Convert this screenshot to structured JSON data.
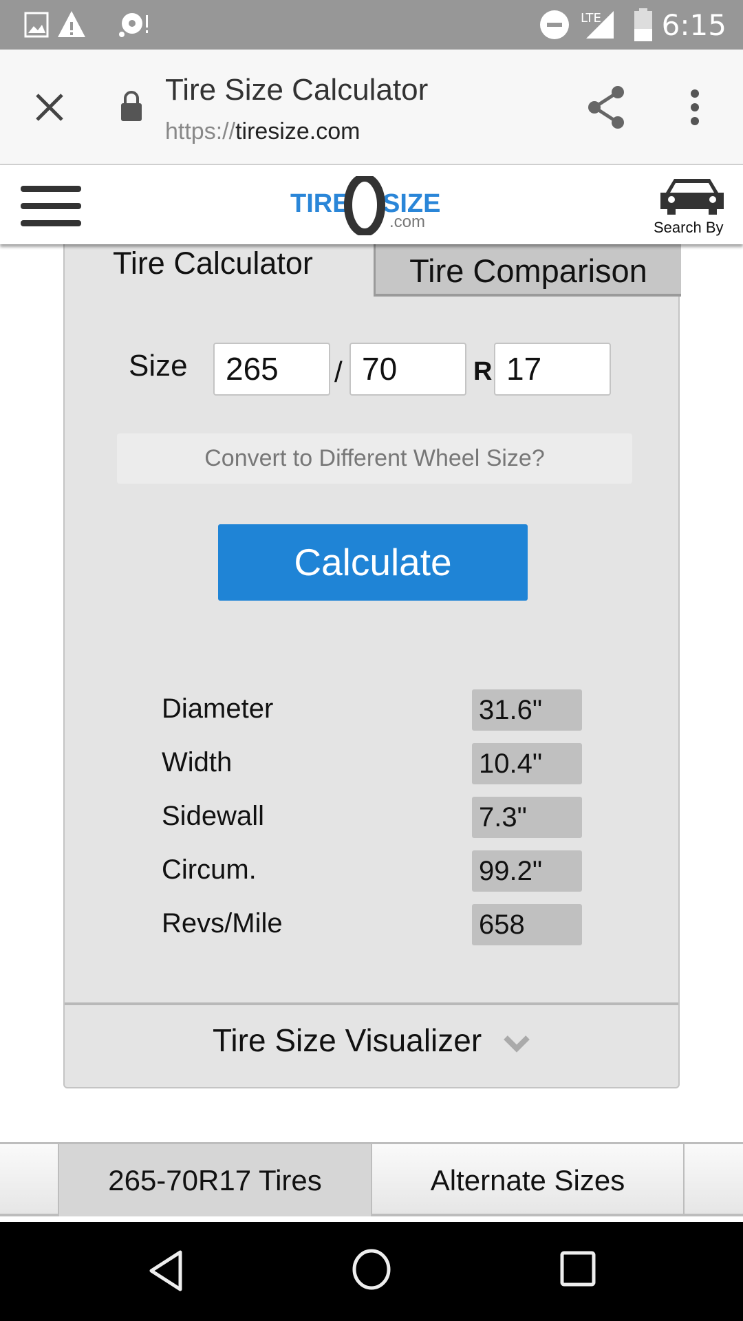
{
  "status_bar": {
    "time": "6:15",
    "battery": "55",
    "network": "LTE",
    "icons": [
      "image-icon",
      "warning-icon",
      "sync-alert-icon",
      "do-not-disturb-icon",
      "signal-icon",
      "battery-icon"
    ]
  },
  "browser": {
    "title": "Tire Size Calculator",
    "url_scheme": "https://",
    "url_host": "tiresize.com"
  },
  "site_header": {
    "logo_text": "TIRESIZE.com",
    "search_by": "Search By"
  },
  "tabs": [
    {
      "label": "Tire Calculator",
      "active": true
    },
    {
      "label": "Tire Comparison",
      "active": false
    }
  ],
  "size_form": {
    "label": "Size",
    "width": "265",
    "separator": "/",
    "aspect": "70",
    "construction": "R",
    "rim": "17"
  },
  "convert_label": "Convert to Different Wheel Size?",
  "calculate_label": "Calculate",
  "accent_color": "#1f84d6",
  "results": [
    {
      "label": "Diameter",
      "value": "31.6\""
    },
    {
      "label": "Width",
      "value": "10.4\""
    },
    {
      "label": "Sidewall",
      "value": "7.3\""
    },
    {
      "label": "Circum.",
      "value": "99.2\""
    },
    {
      "label": "Revs/Mile",
      "value": "658"
    }
  ],
  "visualizer_label": "Tire Size Visualizer",
  "bottom_tabs": [
    {
      "label": "265-70R17 Tires",
      "active": true
    },
    {
      "label": "Alternate Sizes",
      "active": false
    }
  ]
}
